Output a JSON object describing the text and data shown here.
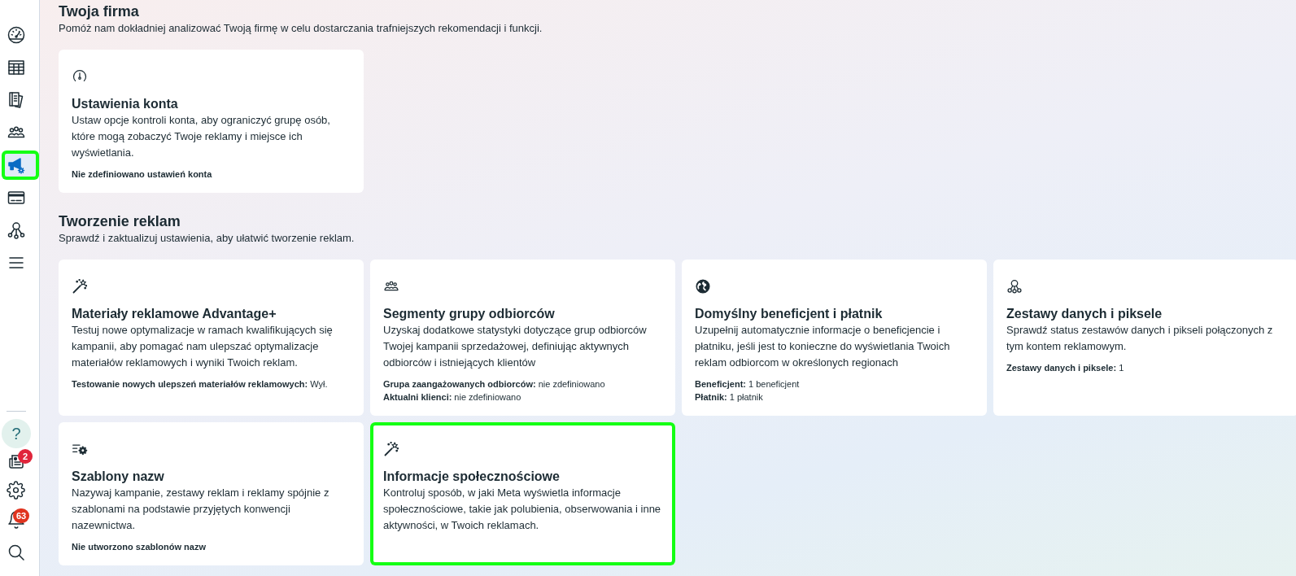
{
  "sidebar": {
    "nav_items": [
      {
        "selected": false,
        "highlighted": false
      },
      {
        "selected": false,
        "highlighted": false
      },
      {
        "selected": false,
        "highlighted": false
      },
      {
        "selected": false,
        "highlighted": false
      },
      {
        "selected": true,
        "highlighted": true
      },
      {
        "selected": false,
        "highlighted": false
      },
      {
        "selected": false,
        "highlighted": false
      },
      {
        "selected": false,
        "highlighted": false
      }
    ],
    "help_button": {
      "label": "?"
    },
    "news_badge": "2",
    "alerts_badge": "63"
  },
  "sections": [
    {
      "title": "Twoja firma",
      "subtitle": "Pomóż nam dokładniej analizować Twoją firmę w celu dostarczania trafniejszych rekomendacji i funkcji.",
      "cards": [
        {
          "title": "Ustawienia konta",
          "description": "Ustaw opcje kontroli konta, aby ograniczyć grupę osób, które mogą zobaczyć Twoje reklamy i miejsce ich wyświetlania.",
          "details": [
            {
              "label": "Nie zdefiniowano ustawień konta"
            }
          ],
          "highlighted": false
        }
      ]
    },
    {
      "title": "Tworzenie reklam",
      "subtitle": "Sprawdź i zaktualizuj ustawienia, aby ułatwić tworzenie reklam.",
      "cards": [
        {
          "title": "Materiały reklamowe Advantage+",
          "description": "Testuj nowe optymalizacje w ramach kwalifikujących się kampanii, aby pomagać nam ulepszać optymalizacje materiałów reklamowych i wyniki Twoich reklam.",
          "details": [
            {
              "label": "Testowanie nowych ulepszeń materiałów reklamowych:",
              "value": "Wył."
            }
          ],
          "highlighted": false
        },
        {
          "title": "Segmenty grupy odbiorców",
          "description": "Uzyskaj dodatkowe statystyki dotyczące grup odbiorców Twojej kampanii sprzedażowej, definiując aktywnych odbiorców i istniejących klientów",
          "details": [
            {
              "label": "Grupa zaangażowanych odbiorców:",
              "value": "nie zdefiniowano"
            },
            {
              "label": "Aktualni klienci:",
              "value": "nie zdefiniowano"
            }
          ],
          "highlighted": false
        },
        {
          "title": "Domyślny beneficjent i płatnik",
          "description": "Uzupełnij automatycznie informacje o beneficjencie i płatniku, jeśli jest to konieczne do wyświetlania Twoich reklam odbiorcom w określonych regionach",
          "details": [
            {
              "label": "Beneficjent:",
              "value": "1 beneficjent"
            },
            {
              "label": "Płatnik:",
              "value": "1 płatnik"
            }
          ],
          "highlighted": false
        },
        {
          "title": "Zestawy danych i piksele",
          "description": "Sprawdź status zestawów danych i pikseli połączonych z tym kontem reklamowym.",
          "details": [
            {
              "label": "Zestawy danych i piksele:",
              "value": "1"
            }
          ],
          "highlighted": false
        },
        {
          "title": "Szablony nazw",
          "description": "Nazywaj kampanie, zestawy reklam i reklamy spójnie z szablonami na podstawie przyjętych konwencji nazewnictwa.",
          "details": [
            {
              "label": "Nie utworzono szablonów nazw"
            }
          ],
          "highlighted": false
        },
        {
          "title": "Informacje społecznościowe",
          "description": "Kontroluj sposób, w jaki Meta wyświetla informacje społecznościowe, takie jak polubienia, obserwowania i inne aktywności, w Twoich reklamach.",
          "highlighted": true
        }
      ]
    }
  ]
}
